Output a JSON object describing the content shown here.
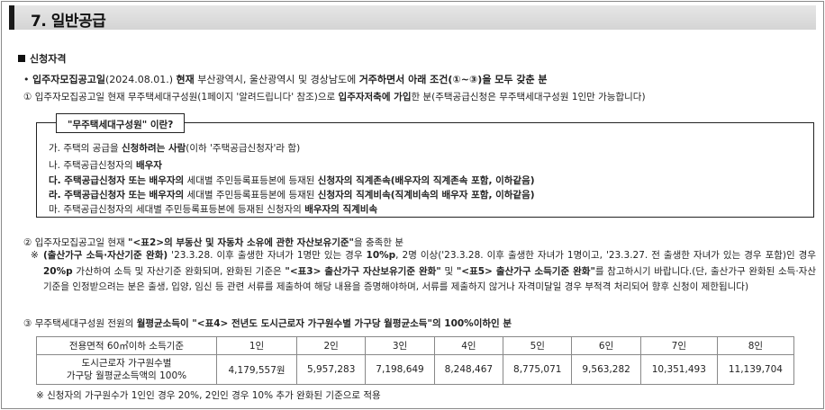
{
  "header": {
    "title": "7. 일반공급"
  },
  "section": {
    "title": "신청자격"
  },
  "main_condition": {
    "bullet": "•",
    "prefix_bold": "입주자모집공고일",
    "date": "(2024.08.01.) ",
    "bold1": "현재",
    "mid": " 부산광역시, 울산광역시 및 경상남도에 ",
    "bold2": "거주하면서 아래 조건(①~③)을 모두 갖춘 분"
  },
  "cond1": {
    "pre": "① 입주자모집공고일 현재 무주택세대구성원(1페이지 '알려드립니다' 참조)으로 ",
    "bold": "입주자저축에 가입",
    "post": "한 분(주택공급신청은 무주택세대구성원 1인만 가능합니다)"
  },
  "box": {
    "tag": "\"무주택세대구성원\" 이란?",
    "lines": [
      {
        "pre": "가. 주택의 공급을 ",
        "bold": "신청하려는 사람",
        "post": "(이하 '주택공급신청자'라 함)"
      },
      {
        "pre": "나. 주택공급신청자의 ",
        "bold": "배우자",
        "post": ""
      },
      {
        "bold0": "다. 주택공급신청자 또는 배우자의",
        "pre": " 세대별 주민등록표등본에 등재된 ",
        "bold": "신청자의 직계존속(배우자의 직계존속 포함, 이하같음)",
        "post": ""
      },
      {
        "bold0": "라. 주택공급신청자 또는 배우자의",
        "pre": " 세대별 주민등록표등본에 등재된 ",
        "bold": "신청자의 직계비속(직계비속의 배우자 포함, 이하같음)",
        "post": ""
      },
      {
        "pre": "마. 주택공급신청자의 세대별 주민등록표등본에 등재된 신청자의 ",
        "bold": "배우자의 직계비속",
        "post": ""
      }
    ]
  },
  "cond2": {
    "pre": "② 입주자모집공고일 현재 ",
    "bold": "\"<표2>의 부동산 및 자동차 소유에 관한 자산보유기준\"",
    "post": "을 충족한 분"
  },
  "note": {
    "mark": "※",
    "bold1": "(출산가구 소득·자산기준 완화)",
    "t1": " '23.3.28. 이후 출생한 자녀가 1명만 있는 경우 ",
    "bold2": "10%p",
    "t2": ", 2명 이상('23.3.28. 이후 출생한 자녀가 1명이고, '23.3.27. 전 출생한 자녀가 있는 경우 포함)인 경우 ",
    "bold3": "20%p",
    "t3": " 가산하여 소득 및 자산기준 완화되며, 완화된 기준은 ",
    "bold4": "\"<표3> 출산가구 자산보유기준 완화\"",
    "t4": " 및 ",
    "bold5": "\"<표5> 출산가구 소득기준 완화\"",
    "t5": "를 참고하시기 바랍니다.(단, 출산가구 완화된 소득·자산기준을 인정받으려는 분은 출생, 입양, 임신 등 관련 서류를 제출하여 해당 내용을 증명해야하며, 서류를 제출하지 않거나 자격미달일 경우 부적격 처리되어 향후 신청이 제한됩니다)"
  },
  "cond3": {
    "pre": "③ 무주택세대구성원 전원의 ",
    "bold": "월평균소득이 \"<표4> 전년도 도시근로자 가구원수별 가구당 월평균소득\"의 100%이하인 분",
    "post": ""
  },
  "table": {
    "header_label": "전용면적 60㎡이하 소득기준",
    "row_label_line1": "도시근로자 가구원수별",
    "row_label_line2": "가구당 월평균소득액의 100%",
    "columns": [
      "1인",
      "2인",
      "3인",
      "4인",
      "5인",
      "6인",
      "7인",
      "8인"
    ],
    "values": [
      "4,179,557원",
      "5,957,283",
      "7,198,649",
      "8,248,467",
      "8,775,071",
      "9,563,282",
      "10,351,493",
      "11,139,704"
    ]
  },
  "footnote": "※ 신청자의 가구원수가 1인인 경우 20%, 2인인 경우 10% 추가 완화된 기준으로 적용"
}
